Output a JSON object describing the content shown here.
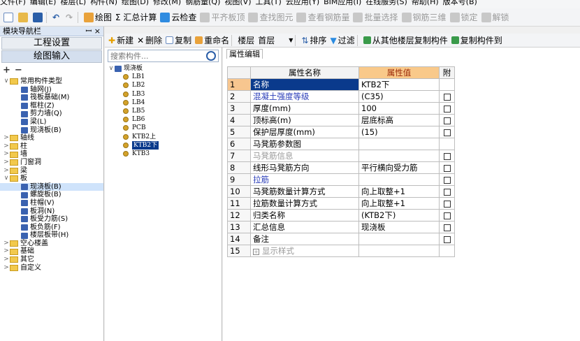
{
  "menu": [
    "文件(F)",
    "编辑(E)",
    "楼层(L)",
    "构件(N)",
    "绘图(D)",
    "修改(M)",
    "钢筋量(Q)",
    "视图(V)",
    "工具(T)",
    "云应用(Y)",
    "BIM应用(I)",
    "在线服务(S)",
    "帮助(H)",
    "版本号(B)"
  ],
  "toolbar1": {
    "draw": "绘图",
    "sum": "Σ 汇总计算",
    "cloud_check": "云检查",
    "flatten": "平齐板顶",
    "find": "查找图元",
    "view_rebar": "查看钢筋量",
    "batch_select": "批量选择",
    "rebar_3d": "钢筋三维",
    "lock": "锁定",
    "unlock": "解锁"
  },
  "toolbar2": {
    "new": "新建",
    "delete": "删除",
    "copy": "复制",
    "rename": "重命名",
    "floor_label": "楼层",
    "floor_value": "首层",
    "sort": "排序",
    "filter": "过滤",
    "copy_from": "从其他楼层复制构件",
    "copy_to": "复制构件到"
  },
  "left": {
    "title": "模块导航栏",
    "pin": "ꟷ ×",
    "btn_project": "工程设置",
    "btn_draw": "绘图输入",
    "tree": [
      {
        "label": "常用构件类型",
        "level": 0,
        "kind": "folder",
        "twisty": "∨"
      },
      {
        "label": "轴网(J)",
        "level": 1,
        "kind": "node"
      },
      {
        "label": "筏板基础(M)",
        "level": 1,
        "kind": "node"
      },
      {
        "label": "框柱(Z)",
        "level": 1,
        "kind": "node"
      },
      {
        "label": "剪力墙(Q)",
        "level": 1,
        "kind": "node"
      },
      {
        "label": "梁(L)",
        "level": 1,
        "kind": "node"
      },
      {
        "label": "现浇板(B)",
        "level": 1,
        "kind": "node"
      },
      {
        "label": "轴线",
        "level": 0,
        "kind": "folder",
        "twisty": ">"
      },
      {
        "label": "柱",
        "level": 0,
        "kind": "folder",
        "twisty": ">"
      },
      {
        "label": "墙",
        "level": 0,
        "kind": "folder",
        "twisty": ">"
      },
      {
        "label": "门窗洞",
        "level": 0,
        "kind": "folder",
        "twisty": ">"
      },
      {
        "label": "梁",
        "level": 0,
        "kind": "folder",
        "twisty": ">"
      },
      {
        "label": "板",
        "level": 0,
        "kind": "folder",
        "twisty": "∨"
      },
      {
        "label": "现浇板(B)",
        "level": 1,
        "kind": "node",
        "selected": true
      },
      {
        "label": "螺旋板(B)",
        "level": 1,
        "kind": "node"
      },
      {
        "label": "柱帽(V)",
        "level": 1,
        "kind": "node"
      },
      {
        "label": "板洞(N)",
        "level": 1,
        "kind": "node"
      },
      {
        "label": "板受力筋(S)",
        "level": 1,
        "kind": "node"
      },
      {
        "label": "板负筋(F)",
        "level": 1,
        "kind": "node"
      },
      {
        "label": "楼层板带(H)",
        "level": 1,
        "kind": "node"
      },
      {
        "label": "空心楼盖",
        "level": 0,
        "kind": "folder",
        "twisty": ">"
      },
      {
        "label": "基础",
        "level": 0,
        "kind": "folder",
        "twisty": ">"
      },
      {
        "label": "其它",
        "level": 0,
        "kind": "folder",
        "twisty": ">"
      },
      {
        "label": "自定义",
        "level": 0,
        "kind": "folder",
        "twisty": ">"
      }
    ]
  },
  "mid": {
    "search_placeholder": "搜索构件...",
    "root": "现浇板",
    "items": [
      "LB1",
      "LB2",
      "LB3",
      "LB4",
      "LB5",
      "LB6",
      "PCB",
      "KTB2上",
      "KTB2下",
      "KTB3"
    ],
    "selected": "KTB2下"
  },
  "right": {
    "tab": "属性编辑",
    "headers": {
      "name": "属性名称",
      "value": "属性值",
      "attach": "附"
    },
    "rows": [
      {
        "num": "1",
        "name": "名称",
        "value": "KTB2下",
        "cb": false,
        "style": "sel"
      },
      {
        "num": "2",
        "name": "混凝土强度等级",
        "value": "(C35)",
        "cb": true,
        "style": "blue"
      },
      {
        "num": "3",
        "name": "厚度(mm)",
        "value": "100",
        "cb": true,
        "style": ""
      },
      {
        "num": "4",
        "name": "顶标高(m)",
        "value": "层底标高",
        "cb": true,
        "style": ""
      },
      {
        "num": "5",
        "name": "保护层厚度(mm)",
        "value": "(15)",
        "cb": true,
        "style": ""
      },
      {
        "num": "6",
        "name": "马凳筋参数图",
        "value": "",
        "cb": false,
        "style": ""
      },
      {
        "num": "7",
        "name": "马凳筋信息",
        "value": "",
        "cb": true,
        "style": "gray"
      },
      {
        "num": "8",
        "name": "线形马凳筋方向",
        "value": "平行横向受力筋",
        "cb": true,
        "style": ""
      },
      {
        "num": "9",
        "name": "拉筋",
        "value": "",
        "cb": true,
        "style": "blue"
      },
      {
        "num": "10",
        "name": "马凳筋数量计算方式",
        "value": "向上取整+1",
        "cb": true,
        "style": ""
      },
      {
        "num": "11",
        "name": "拉筋数量计算方式",
        "value": "向上取整+1",
        "cb": true,
        "style": ""
      },
      {
        "num": "12",
        "name": "归类名称",
        "value": "(KTB2下)",
        "cb": true,
        "style": ""
      },
      {
        "num": "13",
        "name": "汇总信息",
        "value": "现浇板",
        "cb": true,
        "style": ""
      },
      {
        "num": "14",
        "name": "备注",
        "value": "",
        "cb": true,
        "style": ""
      },
      {
        "num": "15",
        "name": "显示样式",
        "value": "",
        "cb": false,
        "style": "gray",
        "expander": true
      }
    ]
  }
}
